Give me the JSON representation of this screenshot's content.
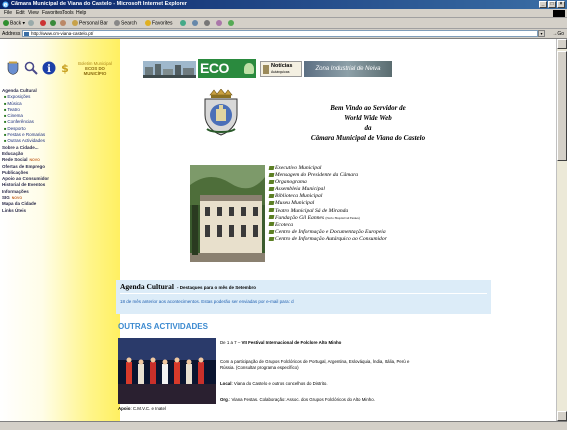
{
  "window": {
    "title": "Câmara Municipal de Viana do Castelo - Microsoft Internet Explorer"
  },
  "menu": [
    "File",
    "Edit",
    "View",
    "Favorites",
    "Tools",
    "Help"
  ],
  "toolbar": {
    "back": "Back",
    "search": "Search",
    "favorites": "Favorites",
    "personal_bar": "Personal Bar"
  },
  "address": {
    "label": "Address",
    "url": "http://www.cm-viana-castelo.pt/",
    "go": "Go"
  },
  "banner": {
    "boletim": "Boletim Municipal",
    "ecos": "ECOS DO MUNICÍPIO",
    "eco": "ECO",
    "noticias": "Notícias",
    "noticias_sub": "Autárquicas",
    "zona": "Zona Industrial de Neiva"
  },
  "leftnav": [
    {
      "label": "Agenda Cultural",
      "type": "main"
    },
    {
      "label": "Exposições",
      "type": "sub"
    },
    {
      "label": "Música",
      "type": "sub"
    },
    {
      "label": "Teatro",
      "type": "sub"
    },
    {
      "label": "Cinema",
      "type": "sub"
    },
    {
      "label": "Conferências",
      "type": "sub"
    },
    {
      "label": "Desporto",
      "type": "sub"
    },
    {
      "label": "Festas e Romarias",
      "type": "sub"
    },
    {
      "label": "Outras Actividades",
      "type": "sub"
    },
    {
      "label": "Sobre a Cidade...",
      "type": "main"
    },
    {
      "label": "Educação",
      "type": "main"
    },
    {
      "label": "Rede Social",
      "type": "main",
      "badge": "NOVO"
    },
    {
      "label": "Ofertas de Emprego",
      "type": "main"
    },
    {
      "label": "Publicações",
      "type": "main"
    },
    {
      "label": "Apoio ao Consumidor",
      "type": "main"
    },
    {
      "label": "Historial de Eventos",
      "type": "main"
    },
    {
      "label": "Informações",
      "type": "main"
    },
    {
      "label": "SIG",
      "type": "main",
      "badge": "NOVO"
    },
    {
      "label": "Mapa da Cidade",
      "type": "main"
    },
    {
      "label": "Links Úteis",
      "type": "main"
    }
  ],
  "welcome": {
    "line1": "Bem Vindo ao Servidor de",
    "line2": "World Wide Web",
    "line3": "da",
    "line4": "Câmara Municipal de Viana do Castelo"
  },
  "links": [
    "Executivo Municipal",
    "Mensagem do Presidente da Câmara",
    "Organograma",
    "Assembleia Municipal",
    "Biblioteca Municipal",
    "Museu Municipal",
    "Teatro Municipal Sá de Miranda",
    "Fundação Gil Eannes",
    "Ecoteca",
    "Centro de Informação e Documentação Europeia",
    "Centro de Informação Autárquico ao Consumidor"
  ],
  "fundacao_note": "(Navio Hospital Gil Eannes)",
  "agenda": {
    "title": "Agenda Cultural",
    "subtitle": "- Destaques para o mês de Setembro",
    "text": "18 de mês anterior aos acontecimentos. Estas poderão ser enviadas por e-mail para: d"
  },
  "outras": "OUTRAS ACTIVIDADES",
  "event": {
    "date": "De 1 a 7 –",
    "title": "VII Festival Internacional de Folclore Alto Minho",
    "desc1": "Com a participação de Grupos Folclóricos de Portugal, Argentina, Eslováquia, Índia, Itália, Perú e",
    "desc2": "Rússia. (Consultar programa específico)",
    "local_label": "Local",
    "local_value": ": Viana do Castelo e outros concelhos do Distrito.",
    "org_label": "Org",
    "org_value": ".: Viana Festas. Colaboração: Assoc. dos Grupos Folclóricos do Alto Minho.",
    "apoio_label": "Apoio",
    "apoio_value": ": C.M.V.C. e Inatel"
  },
  "colors": {
    "titlebar": "#0a246a",
    "sidebar_yellow": "#fff061",
    "agenda_bg": "#dcecf8",
    "accent_blue": "#3c8ad0"
  }
}
